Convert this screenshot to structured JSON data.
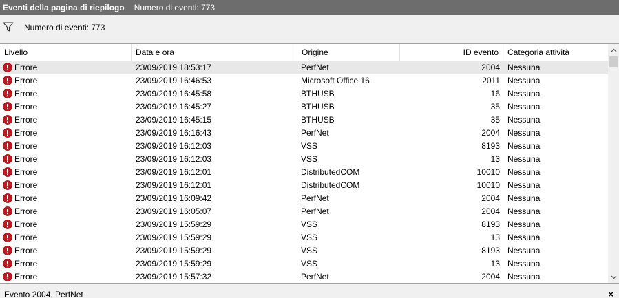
{
  "titlebar": {
    "title": "Eventi della pagina di riepilogo",
    "count": "Numero di eventi: 773"
  },
  "filter": {
    "text": "Numero di eventi: 773",
    "icon": "filter-icon"
  },
  "columns": {
    "level": "Livello",
    "date": "Data e ora",
    "source": "Origine",
    "event_id": "ID evento",
    "category": "Categoria attività"
  },
  "rows": [
    {
      "level": "Errore",
      "date": "23/09/2019 18:53:17",
      "source": "PerfNet",
      "event_id": "2004",
      "category": "Nessuna"
    },
    {
      "level": "Errore",
      "date": "23/09/2019 16:46:53",
      "source": "Microsoft Office 16",
      "event_id": "2011",
      "category": "Nessuna"
    },
    {
      "level": "Errore",
      "date": "23/09/2019 16:45:58",
      "source": "BTHUSB",
      "event_id": "16",
      "category": "Nessuna"
    },
    {
      "level": "Errore",
      "date": "23/09/2019 16:45:27",
      "source": "BTHUSB",
      "event_id": "35",
      "category": "Nessuna"
    },
    {
      "level": "Errore",
      "date": "23/09/2019 16:45:15",
      "source": "BTHUSB",
      "event_id": "35",
      "category": "Nessuna"
    },
    {
      "level": "Errore",
      "date": "23/09/2019 16:16:43",
      "source": "PerfNet",
      "event_id": "2004",
      "category": "Nessuna"
    },
    {
      "level": "Errore",
      "date": "23/09/2019 16:12:03",
      "source": "VSS",
      "event_id": "8193",
      "category": "Nessuna"
    },
    {
      "level": "Errore",
      "date": "23/09/2019 16:12:03",
      "source": "VSS",
      "event_id": "13",
      "category": "Nessuna"
    },
    {
      "level": "Errore",
      "date": "23/09/2019 16:12:01",
      "source": "DistributedCOM",
      "event_id": "10010",
      "category": "Nessuna"
    },
    {
      "level": "Errore",
      "date": "23/09/2019 16:12:01",
      "source": "DistributedCOM",
      "event_id": "10010",
      "category": "Nessuna"
    },
    {
      "level": "Errore",
      "date": "23/09/2019 16:09:42",
      "source": "PerfNet",
      "event_id": "2004",
      "category": "Nessuna"
    },
    {
      "level": "Errore",
      "date": "23/09/2019 16:05:07",
      "source": "PerfNet",
      "event_id": "2004",
      "category": "Nessuna"
    },
    {
      "level": "Errore",
      "date": "23/09/2019 15:59:29",
      "source": "VSS",
      "event_id": "8193",
      "category": "Nessuna"
    },
    {
      "level": "Errore",
      "date": "23/09/2019 15:59:29",
      "source": "VSS",
      "event_id": "13",
      "category": "Nessuna"
    },
    {
      "level": "Errore",
      "date": "23/09/2019 15:59:29",
      "source": "VSS",
      "event_id": "8193",
      "category": "Nessuna"
    },
    {
      "level": "Errore",
      "date": "23/09/2019 15:59:29",
      "source": "VSS",
      "event_id": "13",
      "category": "Nessuna"
    },
    {
      "level": "Errore",
      "date": "23/09/2019 15:57:32",
      "source": "PerfNet",
      "event_id": "2004",
      "category": "Nessuna"
    }
  ],
  "selected_row": 0,
  "footer": {
    "title": "Evento 2004, PerfNet",
    "close": "×"
  },
  "colors": {
    "titlebar_bg": "#6d6d6d",
    "error_icon": "#c4171f",
    "selected_row": "#e8e8e8"
  }
}
